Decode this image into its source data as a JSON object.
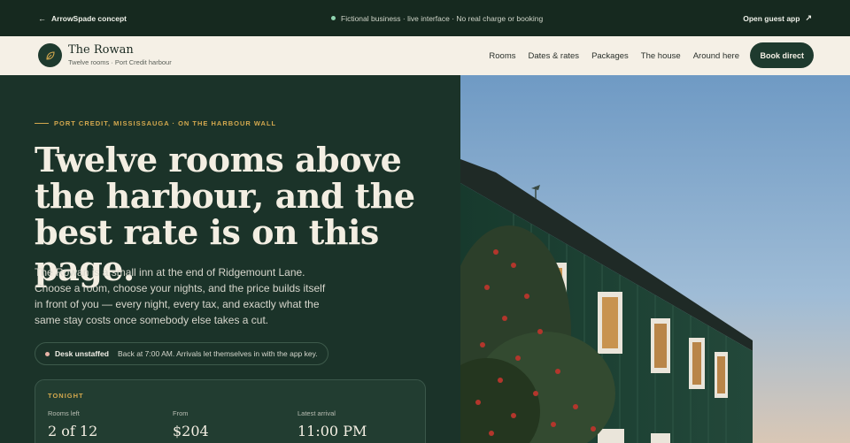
{
  "topbar": {
    "back_label": "ArrowSpade concept",
    "notice": "Fictional business · live interface · No real charge or booking",
    "guest_app_label": "Open guest app"
  },
  "nav": {
    "brand_name": "The Rowan",
    "brand_sub": "Twelve rooms · Port Credit harbour",
    "links": [
      "Rooms",
      "Dates & rates",
      "Packages",
      "The house",
      "Around here"
    ],
    "cta": "Book direct"
  },
  "hero": {
    "eyebrow": "PORT CREDIT, MISSISSAUGA · ON THE HARBOUR WALL",
    "headline": "Twelve rooms above the harbour, and the best rate is on this page.",
    "intro": "The Rowan is a small inn at the end of Ridgemount Lane. Choose a room, choose your nights, and the price builds itself in front of you — every night, every tax, and exactly what the same stay costs once somebody else takes a cut.",
    "status": {
      "label": "Desk unstaffed",
      "text": "Back at 7:00 AM. Arrivals let themselves in with the app key."
    },
    "tonight": {
      "tag": "TONIGHT",
      "stats": [
        {
          "label": "Rooms left",
          "value": "2 of 12"
        },
        {
          "label": "From",
          "value": "$204"
        },
        {
          "label": "Latest arrival",
          "value": "11:00 PM"
        }
      ]
    }
  },
  "colors": {
    "brand_dark": "#1b3329",
    "accent_gold": "#d3a84e",
    "cream": "#f5f0e6"
  },
  "icons": [
    "arrow-left-icon",
    "status-dot-icon",
    "arrow-up-right-icon",
    "leaf-icon"
  ]
}
